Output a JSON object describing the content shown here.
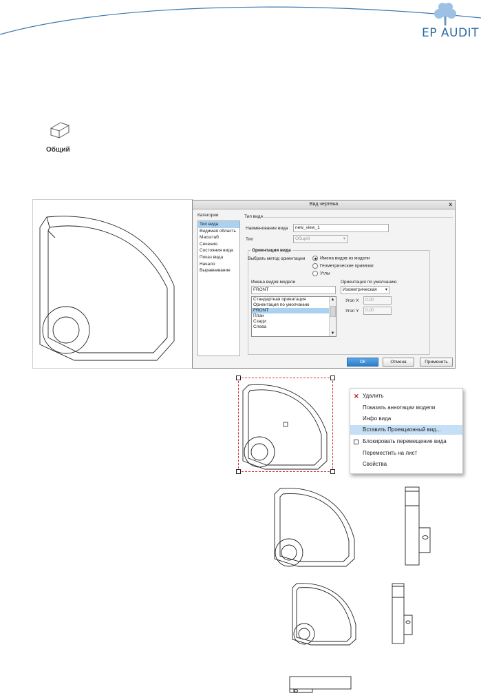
{
  "header": {
    "logo_text": "EP AUDIT"
  },
  "ribbon": {
    "general_button_label": "Общий"
  },
  "dialog": {
    "title": "Вид чертежа",
    "close_label": "x",
    "categories_label": "Категории",
    "categories": [
      "Тип вида",
      "Видимая область",
      "Масштаб",
      "Сечения",
      "Состояния вида",
      "Показ вида",
      "Начало",
      "Выравнивание"
    ],
    "section_title": "Тип вида",
    "view_name_label": "Наименование вида",
    "view_name_value": "new_view_1",
    "type_label": "Тип",
    "type_value": "Общий",
    "orientation_group_label": "Ориентация вида",
    "orientation_method_label": "Выбрать метод ориентации",
    "radio_options": [
      "Имена видов из модели",
      "Геометрические привязки",
      "Углы"
    ],
    "model_view_names_label": "Имена видов модели",
    "model_view_name_value": "FRONT",
    "model_views": [
      "Стандартная ориентация",
      "Ориентация по умолчанию",
      "FRONT",
      "План",
      "Сзади",
      "Слева"
    ],
    "default_orientation_label": "Ориентация по умолчанию",
    "default_orientation_value": "Изометрическая",
    "angle_x_label": "Угол X",
    "angle_x_value": "0.00",
    "angle_y_label": "Угол Y",
    "angle_y_value": "0.00",
    "ok_label": "ОК",
    "cancel_label": "Отмена",
    "apply_label": "Применить"
  },
  "context_menu": {
    "items": [
      {
        "label": "Удалить",
        "icon": "delete-x-icon"
      },
      {
        "label": "Показать аннотации модели"
      },
      {
        "label": "Инфо вида"
      },
      {
        "label": "Вставить Проекционный вид..."
      },
      {
        "label": "Блокировать перемещение вида",
        "icon": "checkbox-icon"
      },
      {
        "label": "Переместить на лист"
      },
      {
        "label": "Свойства"
      }
    ]
  },
  "colors": {
    "logo_blue": "#2b6aa0",
    "selection_blue": "#a9d1f1",
    "selection_red": "#d33030",
    "ok_button": "#2d7ec8"
  }
}
